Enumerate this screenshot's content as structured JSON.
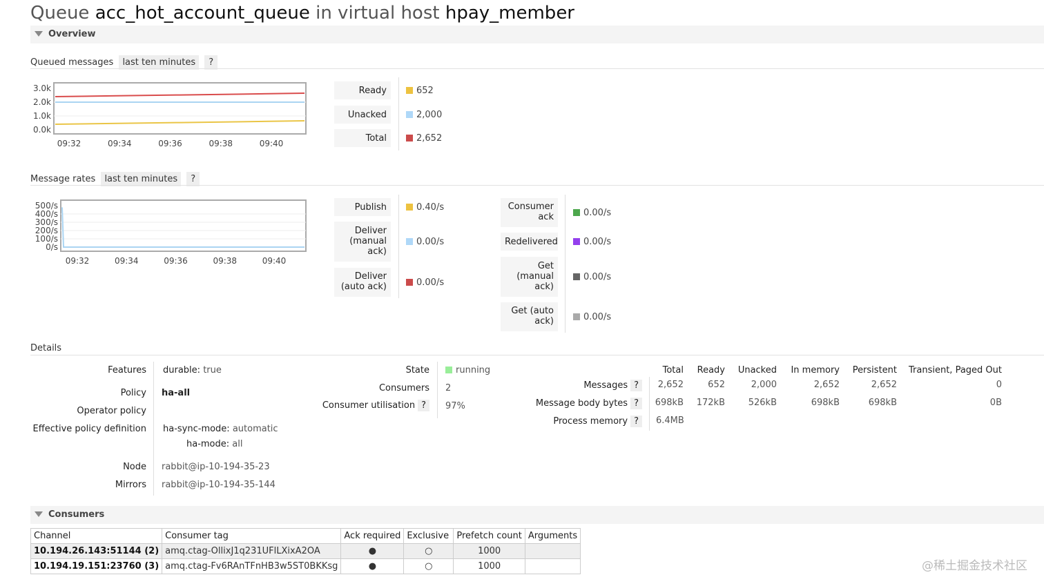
{
  "title": {
    "word_queue": "Queue",
    "queue_name": "acc_hot_account_queue",
    "word_in_vhost": "in virtual host",
    "vhost_name": "hpay_member"
  },
  "overview": {
    "header": "Overview",
    "queued_messages": {
      "label": "Queued messages",
      "range": "last ten minutes",
      "help": "?",
      "chart_data": {
        "type": "line",
        "x": [
          "09:32",
          "09:34",
          "09:36",
          "09:38",
          "09:40"
        ],
        "y_ticks": [
          "3.0k",
          "2.0k",
          "1.0k",
          "0.0k"
        ],
        "ylim": [
          0,
          3000
        ],
        "series": [
          {
            "name": "Total",
            "color": "#d94c4c",
            "values": [
              2400,
              2460,
              2520,
              2580,
              2652
            ]
          },
          {
            "name": "Unacked",
            "color": "#aad4f2",
            "values": [
              2000,
              2000,
              2000,
              2000,
              2000
            ]
          },
          {
            "name": "Ready",
            "color": "#eac546",
            "values": [
              400,
              460,
              520,
              580,
              652
            ]
          }
        ]
      },
      "legend": [
        {
          "label": "Ready",
          "value": "652",
          "color": "#edc240"
        },
        {
          "label": "Unacked",
          "value": "2,000",
          "color": "#afd8f8"
        },
        {
          "label": "Total",
          "value": "2,652",
          "color": "#cb4b4b"
        }
      ]
    },
    "message_rates": {
      "label": "Message rates",
      "range": "last ten minutes",
      "help": "?",
      "chart_data": {
        "type": "line",
        "x": [
          "09:32",
          "09:34",
          "09:36",
          "09:38",
          "09:40"
        ],
        "y_ticks": [
          "500/s",
          "400/s",
          "300/s",
          "200/s",
          "100/s",
          "0/s"
        ],
        "ylim": [
          0,
          500
        ],
        "series": [
          {
            "name": "Publish",
            "color": "#aad4f2",
            "values": [
              480,
              0,
              0,
              0,
              0
            ]
          }
        ]
      },
      "left_legend": [
        {
          "label": "Publish",
          "value": "0.40/s",
          "color": "#edc240"
        },
        {
          "label": "Deliver (manual ack)",
          "value": "0.00/s",
          "color": "#afd8f8"
        },
        {
          "label": "Deliver (auto ack)",
          "value": "0.00/s",
          "color": "#cb4b4b"
        }
      ],
      "right_legend": [
        {
          "label": "Consumer ack",
          "value": "0.00/s",
          "color": "#4da74d"
        },
        {
          "label": "Redelivered",
          "value": "0.00/s",
          "color": "#9440ed"
        },
        {
          "label": "Get (manual ack)",
          "value": "0.00/s",
          "color": "#666666"
        },
        {
          "label": "Get (auto ack)",
          "value": "0.00/s",
          "color": "#aaaaaa"
        }
      ]
    }
  },
  "details": {
    "label": "Details",
    "features_label": "Features",
    "features_key": "durable:",
    "features_value": "true",
    "policy_label": "Policy",
    "policy_value": "ha-all",
    "operator_policy_label": "Operator policy",
    "effective_policy_label": "Effective policy definition",
    "eff_1_key": "ha-sync-mode:",
    "eff_1_value": "automatic",
    "eff_2_key": "ha-mode:",
    "eff_2_value": "all",
    "node_label": "Node",
    "node_value": "rabbit@ip-10-194-35-23",
    "mirrors_label": "Mirrors",
    "mirrors_value": "rabbit@ip-10-194-35-144",
    "state_label": "State",
    "state_value": "running",
    "state_color": "#99ee99",
    "consumers_label": "Consumers",
    "consumers_value": "2",
    "utilisation_label": "Consumer utilisation",
    "utilisation_help": "?",
    "utilisation_value": "97%",
    "stats_headers": [
      "Total",
      "Ready",
      "Unacked",
      "In memory",
      "Persistent",
      "Transient, Paged Out"
    ],
    "stats_rows": [
      {
        "label": "Messages",
        "help": "?",
        "values": [
          "2,652",
          "652",
          "2,000",
          "2,652",
          "2,652",
          "0"
        ]
      },
      {
        "label": "Message body bytes",
        "help": "?",
        "values": [
          "698kB",
          "172kB",
          "526kB",
          "698kB",
          "698kB",
          "0B"
        ]
      },
      {
        "label": "Process memory",
        "help": "?",
        "values": [
          "6.4MB",
          "",
          "",
          "",
          "",
          ""
        ]
      }
    ]
  },
  "consumers": {
    "header": "Consumers",
    "columns": [
      "Channel",
      "Consumer tag",
      "Ack required",
      "Exclusive",
      "Prefetch count",
      "Arguments"
    ],
    "rows": [
      {
        "channel": "10.194.26.143:51144 (2)",
        "tag": "amq.ctag-OllixJ1q231UFlLXixA2OA",
        "ack": "●",
        "exclusive": "○",
        "prefetch": "1000",
        "args": ""
      },
      {
        "channel": "10.194.19.151:23760 (3)",
        "tag": "amq.ctag-Fv6RAnTFnHB3w5ST0BKKsg",
        "ack": "●",
        "exclusive": "○",
        "prefetch": "1000",
        "args": ""
      }
    ]
  },
  "watermark": "@稀土掘金技术社区"
}
